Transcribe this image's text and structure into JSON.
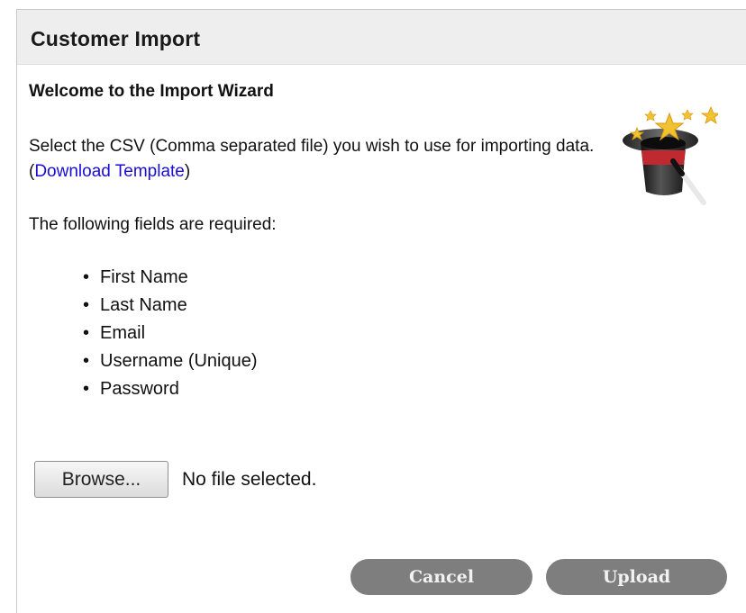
{
  "dialog": {
    "title": "Customer Import"
  },
  "wizard": {
    "welcome": "Welcome to the Import Wizard",
    "intro_text": "Select the CSV (Comma separated file) you wish to use for importing data. (",
    "template_link": "Download Template",
    "intro_close": ")",
    "required_label": "The following fields are required:",
    "required_fields": [
      "First Name",
      "Last Name",
      "Email",
      "Username (Unique)",
      "Password"
    ],
    "icon": "magic-hat-wand-icon"
  },
  "file_input": {
    "browse_label": "Browse...",
    "status": "No file selected."
  },
  "actions": {
    "cancel_label": "Cancel",
    "upload_label": "Upload"
  },
  "colors": {
    "titlebar": "#eeeeee",
    "link": "#1a0dd6",
    "action_button": "#7e7e7e"
  }
}
